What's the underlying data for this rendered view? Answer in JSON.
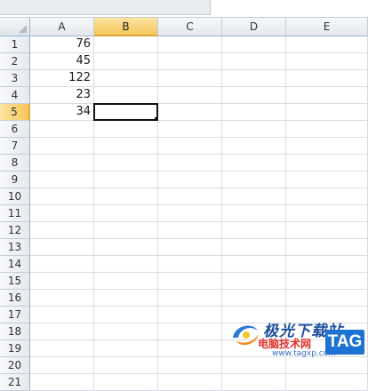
{
  "columns": [
    "A",
    "B",
    "C",
    "D",
    "E"
  ],
  "selected_column": "B",
  "rows": [
    "1",
    "2",
    "3",
    "4",
    "5",
    "6",
    "7",
    "8",
    "9",
    "10",
    "11",
    "12",
    "13",
    "14",
    "15",
    "16",
    "17",
    "18",
    "19",
    "20",
    "21"
  ],
  "selected_row": "5",
  "cells": {
    "A1": "76",
    "A2": "45",
    "A3": "122",
    "A4": "23",
    "A5": "34"
  },
  "active_cell": "B5",
  "colors": {
    "selected_header": "#f6c75b",
    "grid_line": "#d8dde3",
    "header_border": "#9eb6ce"
  },
  "watermark": {
    "line1": "极光下载站",
    "line2": "电脑技术网",
    "line3": "www.tagxp.com",
    "badge": "TAG"
  }
}
